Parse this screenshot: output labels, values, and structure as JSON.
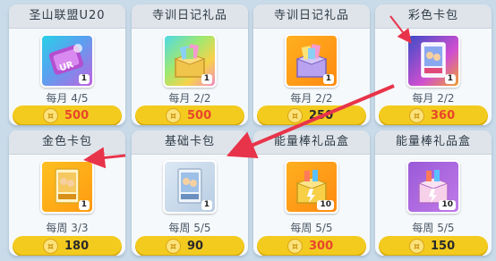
{
  "colors": {
    "price_bar": "#f3cb1f",
    "price_red": "#e8462a",
    "price_dark": "#2a2a2a",
    "arrow": "#e8344a"
  },
  "cards": [
    {
      "title": "圣山联盟U20",
      "count": "1",
      "limit": "每月 4/5",
      "price": "500",
      "price_style": "red",
      "icon": "ur-ticket-icon"
    },
    {
      "title": "寺训日记礼品",
      "count": "1",
      "limit": "每月 2/2",
      "price": "500",
      "price_style": "red",
      "icon": "rainbow-gift-box-icon"
    },
    {
      "title": "寺训日记礼品",
      "count": "1",
      "limit": "每月 2/2",
      "price": "250",
      "price_style": "dark",
      "icon": "purple-gift-box-icon"
    },
    {
      "title": "彩色卡包",
      "count": "1",
      "limit": "每月 2/2",
      "price": "360",
      "price_style": "red",
      "icon": "color-card-pack-icon"
    },
    {
      "title": "金色卡包",
      "count": "1",
      "limit": "每周 3/3",
      "price": "180",
      "price_style": "dark",
      "icon": "gold-card-pack-icon"
    },
    {
      "title": "基础卡包",
      "count": "1",
      "limit": "每周 5/5",
      "price": "90",
      "price_style": "dark",
      "icon": "basic-card-pack-icon"
    },
    {
      "title": "能量棒礼品盒",
      "count": "10",
      "limit": "每周 5/5",
      "price": "300",
      "price_style": "red",
      "icon": "energy-bar-gift-box-icon"
    },
    {
      "title": "能量棒礼品盒",
      "count": "10",
      "limit": "每周 5/5",
      "price": "150",
      "price_style": "dark",
      "icon": "energy-bar-gift-box-purple-icon"
    }
  ]
}
